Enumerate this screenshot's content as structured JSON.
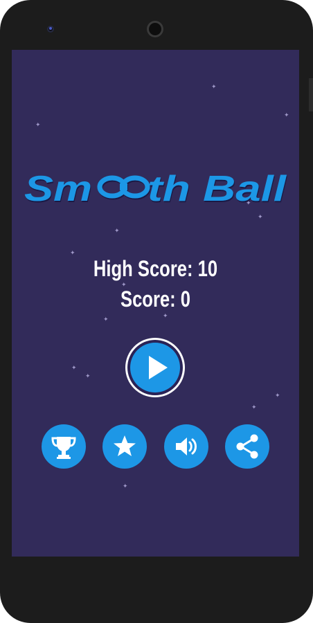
{
  "game": {
    "title_left": "Sm",
    "title_right": "th Ball",
    "high_score_label": "High Score:",
    "high_score": "10",
    "score_label": "Score:",
    "score": "0"
  },
  "buttons": {
    "play_icon": "play-icon",
    "leaderboard_icon": "trophy-icon",
    "rate_icon": "star-icon",
    "sound_icon": "speaker-icon",
    "share_icon": "share-icon"
  },
  "colors": {
    "background": "#322b5a",
    "accent": "#1d97e6",
    "text": "#ffffff",
    "phone_frame": "#1c1c1c"
  }
}
